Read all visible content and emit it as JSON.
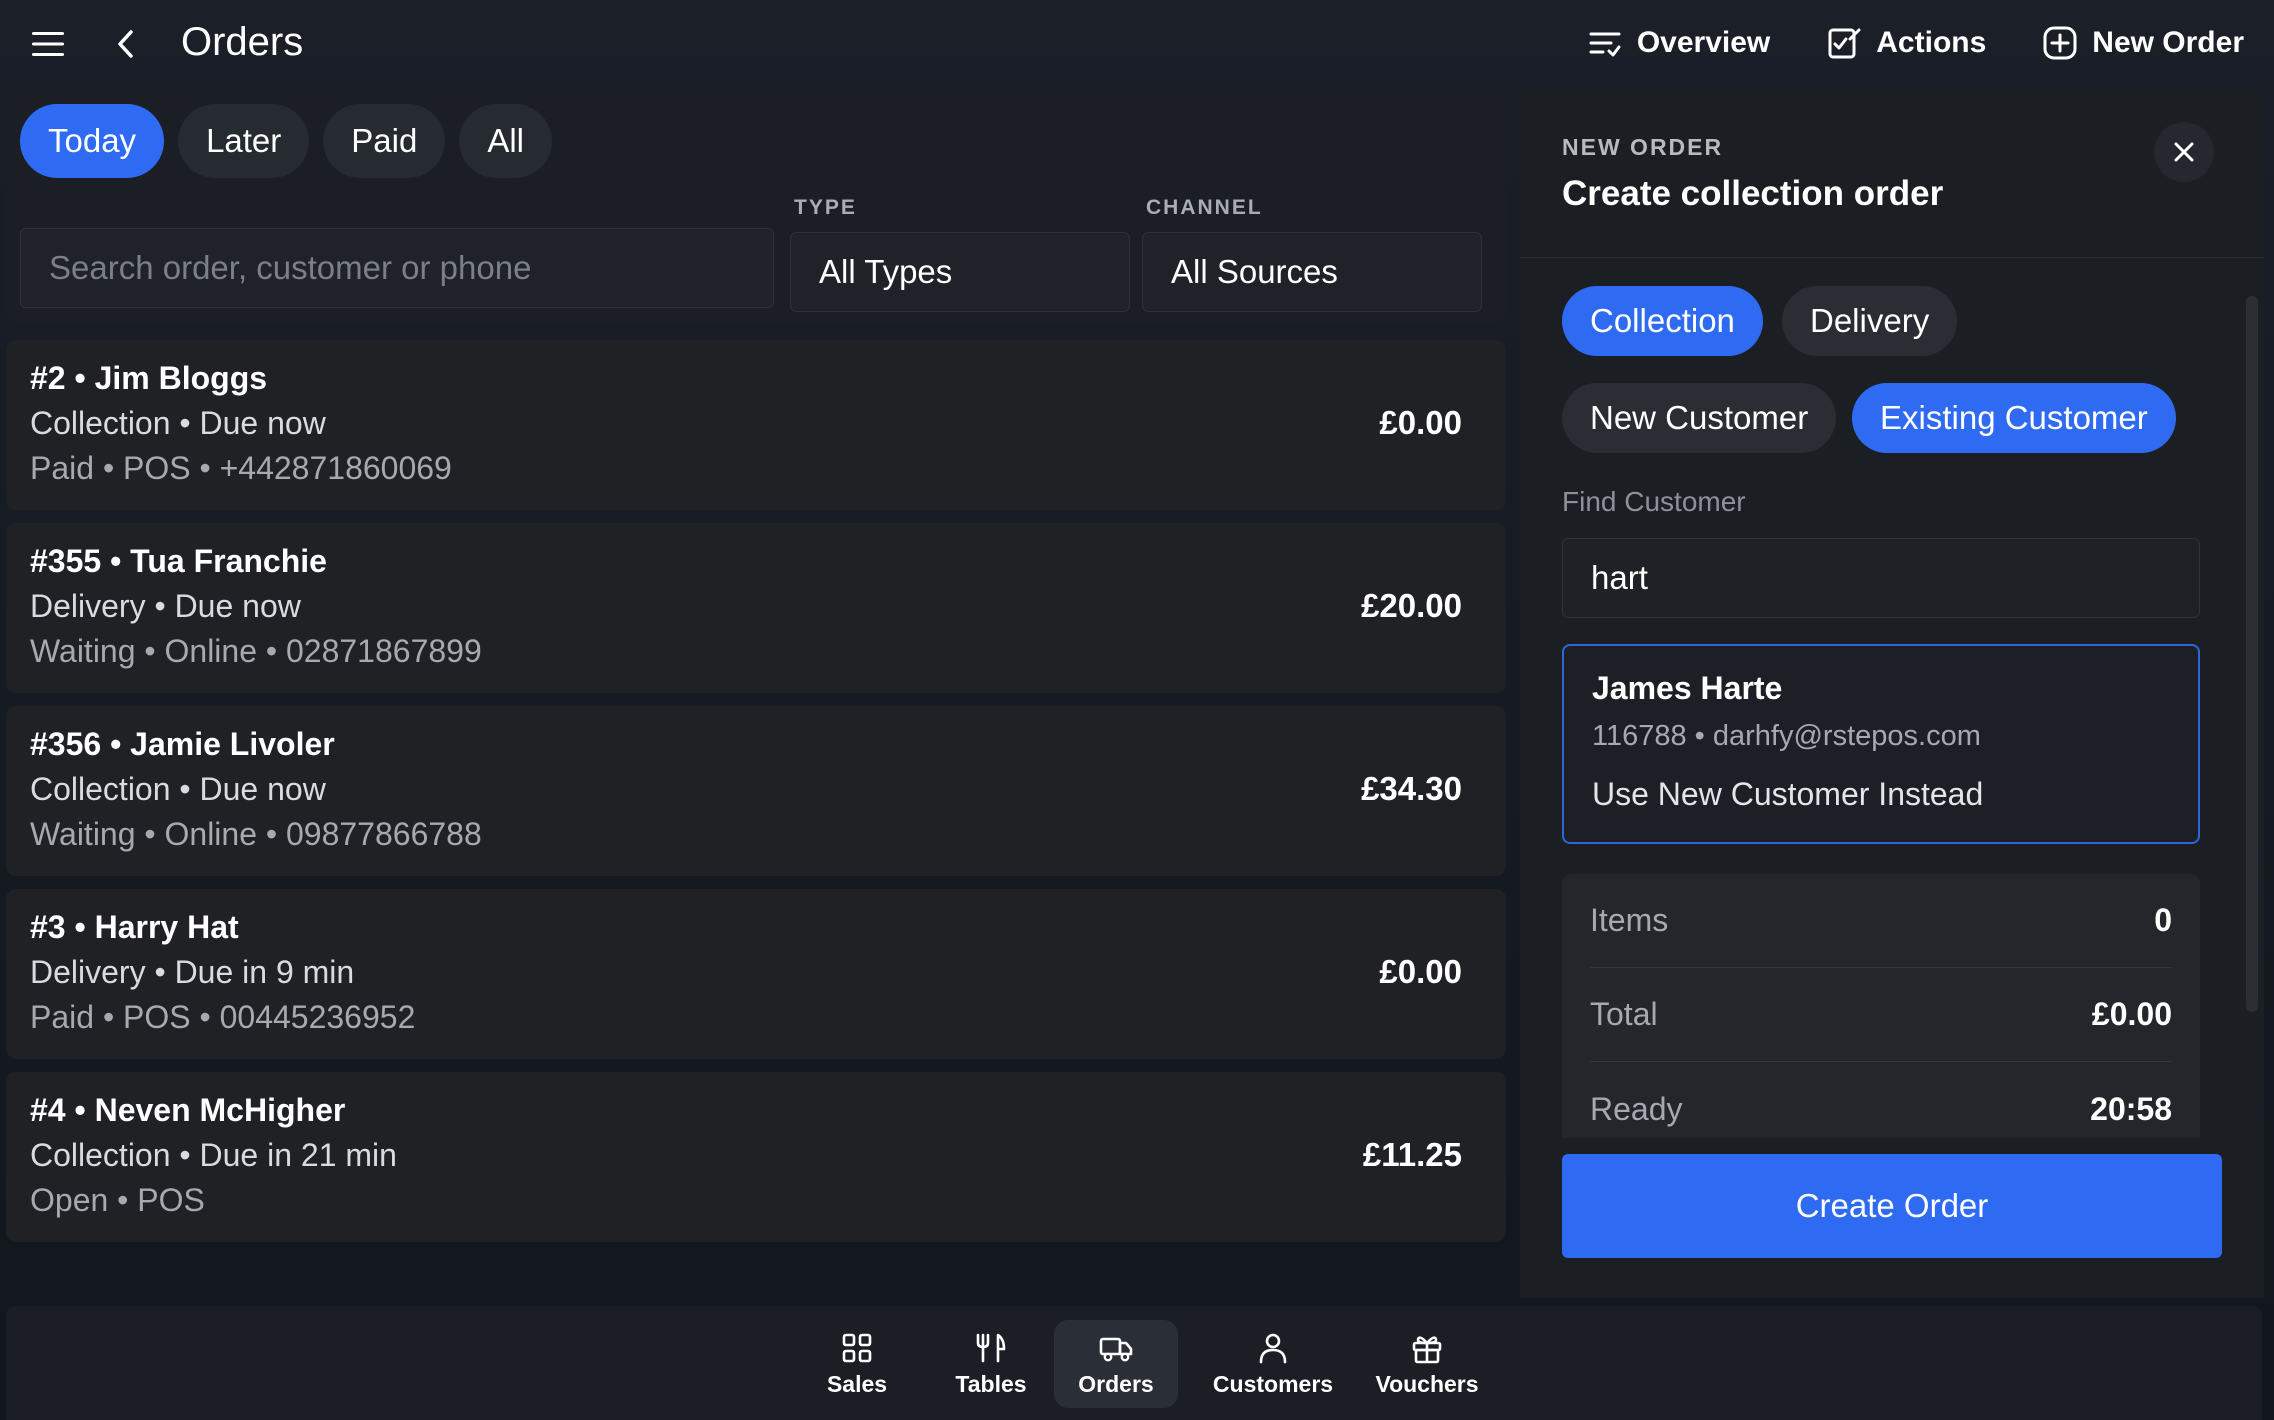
{
  "header": {
    "title": "Orders",
    "menu_icon": "menu-icon",
    "back_icon": "chevron-left-icon",
    "actions": [
      {
        "label": "Overview",
        "icon": "filter-lines-icon"
      },
      {
        "label": "Actions",
        "icon": "edit-checklist-icon"
      },
      {
        "label": "New Order",
        "icon": "plus-circle-icon"
      }
    ]
  },
  "filters": {
    "tabs": [
      {
        "label": "Today",
        "active": true
      },
      {
        "label": "Later",
        "active": false
      },
      {
        "label": "Paid",
        "active": false
      },
      {
        "label": "All",
        "active": false
      }
    ],
    "search_placeholder": "Search order, customer or phone",
    "type_label": "TYPE",
    "type_value": "All Types",
    "channel_label": "CHANNEL",
    "channel_value": "All Sources"
  },
  "orders": [
    {
      "title": "#2 • Jim Bloggs",
      "line2": "Collection • Due now",
      "line3": "Paid • POS • +442871860069",
      "amount": "£0.00"
    },
    {
      "title": "#355 • Tua Franchie",
      "line2": "Delivery • Due now",
      "line3": "Waiting • Online • 02871867899",
      "amount": "£20.00"
    },
    {
      "title": "#356 • Jamie Livoler",
      "line2": "Collection • Due now",
      "line3": "Waiting • Online • 09877866788",
      "amount": "£34.30"
    },
    {
      "title": "#3 • Harry Hat",
      "line2": "Delivery • Due in 9 min",
      "line3": "Paid • POS • 00445236952",
      "amount": "£0.00"
    },
    {
      "title": "#4 • Neven McHigher",
      "line2": "Collection • Due in 21 min",
      "line3": "Open • POS",
      "amount": "£11.25"
    }
  ],
  "new_order": {
    "eyebrow": "NEW ORDER",
    "title": "Create collection order",
    "close_icon": "close-icon",
    "order_types": [
      {
        "label": "Collection",
        "active": true
      },
      {
        "label": "Delivery",
        "active": false
      }
    ],
    "customer_modes": [
      {
        "label": "New Customer",
        "active": false
      },
      {
        "label": "Existing Customer",
        "active": true
      }
    ],
    "find_label": "Find Customer",
    "find_value": "hart",
    "result": {
      "name": "James Harte",
      "details": "116788 • darhfy@rstepos.com",
      "alt_action": "Use New Customer Instead"
    },
    "summary": [
      {
        "key": "Items",
        "value": "0"
      },
      {
        "key": "Total",
        "value": "£0.00"
      },
      {
        "key": "Ready",
        "value": "20:58"
      }
    ],
    "create_label": "Create Order"
  },
  "bottom_nav": [
    {
      "label": "Sales",
      "icon": "grid-icon",
      "active": false
    },
    {
      "label": "Tables",
      "icon": "cutlery-icon",
      "active": false
    },
    {
      "label": "Orders",
      "icon": "delivery-truck-icon",
      "active": true
    },
    {
      "label": "Customers",
      "icon": "person-icon",
      "active": false
    },
    {
      "label": "Vouchers",
      "icon": "gift-icon",
      "active": false
    }
  ],
  "colors": {
    "accent": "#2f6bf2",
    "background": "#14181f",
    "card": "#1f2125"
  }
}
